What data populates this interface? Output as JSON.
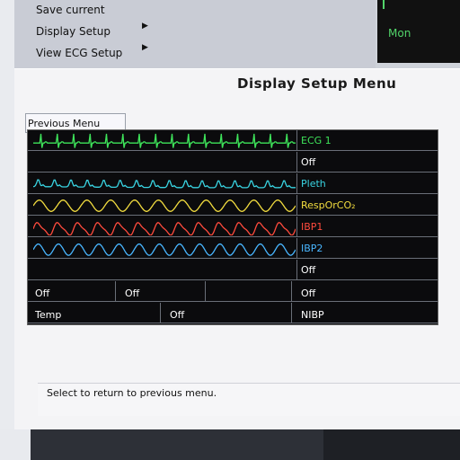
{
  "background_menu": {
    "items": [
      {
        "label": "Save current",
        "has_arrow": false
      },
      {
        "label": "Display Setup",
        "has_arrow": true
      },
      {
        "label": "View ECG Setup",
        "has_arrow": true
      }
    ],
    "arrow_glyph": "▶"
  },
  "monitor": {
    "label": "Mon",
    "color": "#52d46a"
  },
  "dialog": {
    "title": "Display Setup Menu",
    "previous_menu_label": "Previous Menu",
    "status_text": "Select to return to previous menu."
  },
  "channels": [
    {
      "label": "ECG 1",
      "color": "#3ee35a",
      "wave": "ecg"
    },
    {
      "label": "Off",
      "color": "#ffffff",
      "wave": "none"
    },
    {
      "label": "Pleth",
      "color": "#39d4e2",
      "wave": "pleth"
    },
    {
      "label": "RespOrCO₂",
      "color": "#f3dd3f",
      "wave": "resp"
    },
    {
      "label": "IBP1",
      "color": "#ff4b3d",
      "wave": "ibp1"
    },
    {
      "label": "IBP2",
      "color": "#49b6ff",
      "wave": "ibp2"
    },
    {
      "label": "Off",
      "color": "#ffffff",
      "wave": "none"
    }
  ],
  "bottom_rows": [
    [
      {
        "label": "Off"
      },
      {
        "label": "Off"
      },
      {
        "label": ""
      },
      {
        "label": "Off"
      }
    ],
    [
      {
        "label": "Temp"
      },
      {
        "label": "Off"
      },
      {
        "label": "NIBP"
      }
    ]
  ]
}
